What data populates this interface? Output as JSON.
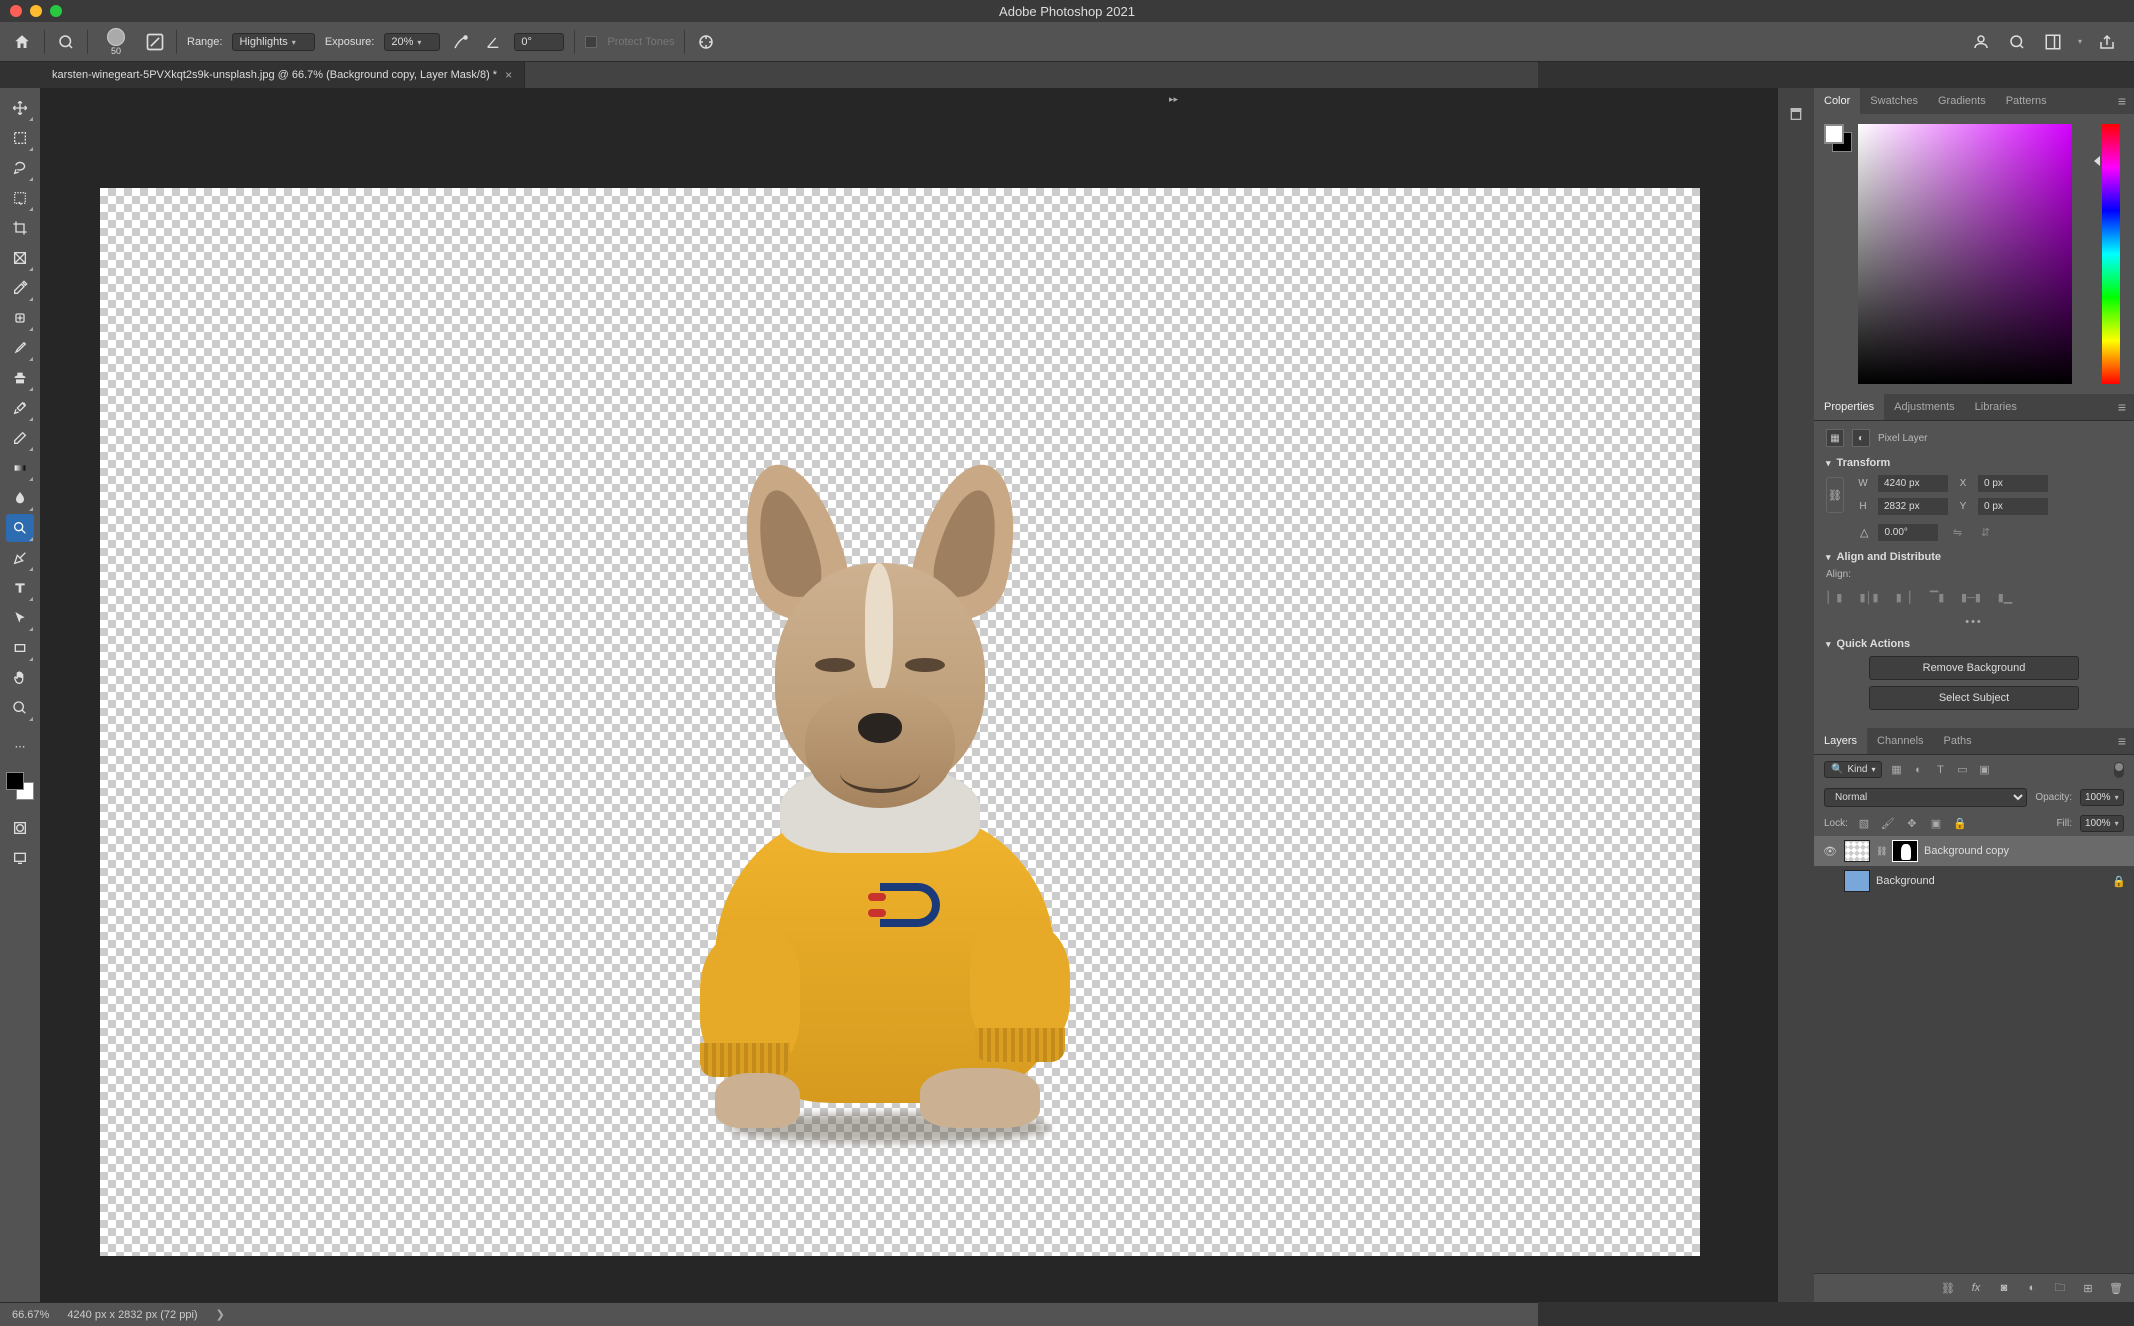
{
  "app_title": "Adobe Photoshop 2021",
  "options_bar": {
    "brush_size": "50",
    "range_label": "Range:",
    "range_value": "Highlights",
    "exposure_label": "Exposure:",
    "exposure_value": "20%",
    "angle_value": "0°",
    "protect_tones_label": "Protect Tones"
  },
  "document_tab": {
    "title": "karsten-winegeart-5PVXkqt2s9k-unsplash.jpg @ 66.7% (Background copy, Layer Mask/8) *"
  },
  "color_panel": {
    "tabs": [
      "Color",
      "Swatches",
      "Gradients",
      "Patterns"
    ],
    "active_tab": "Color"
  },
  "properties_panel": {
    "tabs": [
      "Properties",
      "Adjustments",
      "Libraries"
    ],
    "active_tab": "Properties",
    "subtitle": "Pixel Layer",
    "sections": {
      "transform": {
        "title": "Transform",
        "w_label": "W",
        "w_value": "4240 px",
        "h_label": "H",
        "h_value": "2832 px",
        "x_label": "X",
        "x_value": "0 px",
        "y_label": "Y",
        "y_value": "0 px",
        "rotation": "0.00°"
      },
      "align": {
        "title": "Align and Distribute",
        "label": "Align:"
      },
      "quick_actions": {
        "title": "Quick Actions",
        "remove_bg": "Remove Background",
        "select_subject": "Select Subject"
      }
    }
  },
  "layers_panel": {
    "tabs": [
      "Layers",
      "Channels",
      "Paths"
    ],
    "active_tab": "Layers",
    "filter_type": "Kind",
    "blend_mode": "Normal",
    "opacity_label": "Opacity:",
    "opacity_value": "100%",
    "lock_label": "Lock:",
    "fill_label": "Fill:",
    "fill_value": "100%",
    "layers": [
      {
        "name": "Background copy",
        "visible": true,
        "selected": true,
        "has_mask": true
      },
      {
        "name": "Background",
        "visible": false,
        "selected": false,
        "locked": true
      }
    ]
  },
  "statusbar": {
    "zoom": "66.67%",
    "doc_info": "4240 px x 2832 px (72 ppi)"
  }
}
